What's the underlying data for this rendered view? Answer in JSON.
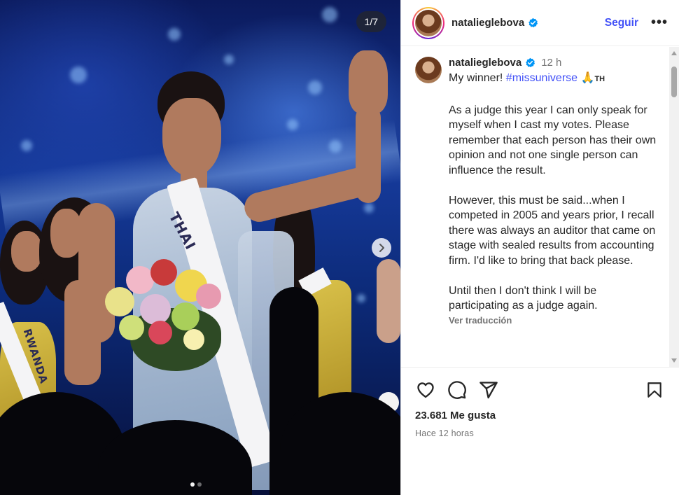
{
  "media": {
    "counter": "1/7",
    "sash_left": "RWANDA",
    "sash_main": "THAI",
    "slide_total": 2,
    "slide_active": 0
  },
  "header": {
    "username": "natalieglebova",
    "follow_label": "Seguir",
    "more_label": "•••"
  },
  "caption": {
    "username": "natalieglebova",
    "time_ago": "12 h",
    "line1_text": "My winner! ",
    "line1_hashtag": "#missuniverse",
    "line1_emoji": " 🙏",
    "line1_flag": "TH",
    "body": "As a judge this year I can only speak for myself when I cast my votes. Please remember that each person has their own opinion and not one single person can influence the result.\n\nHowever, this must be said...when I competed in 2005 and years prior, I recall there was always an auditor that came on stage with sealed results from accounting firm. I'd like to bring that back please.\n\nUntil then I don't think I will be participating as a judge again.",
    "translate_label": "Ver traducción"
  },
  "actions": {
    "likes": "23.681 Me gusta",
    "posted": "Hace 12 horas"
  },
  "colors": {
    "link_blue": "#4150f7",
    "verified_blue": "#0095f6",
    "text": "#262626",
    "muted": "#737373"
  },
  "icons": [
    "heart-icon",
    "comment-icon",
    "share-icon",
    "bookmark-icon",
    "verified-badge-icon",
    "chevron-right-icon",
    "more-icon"
  ]
}
